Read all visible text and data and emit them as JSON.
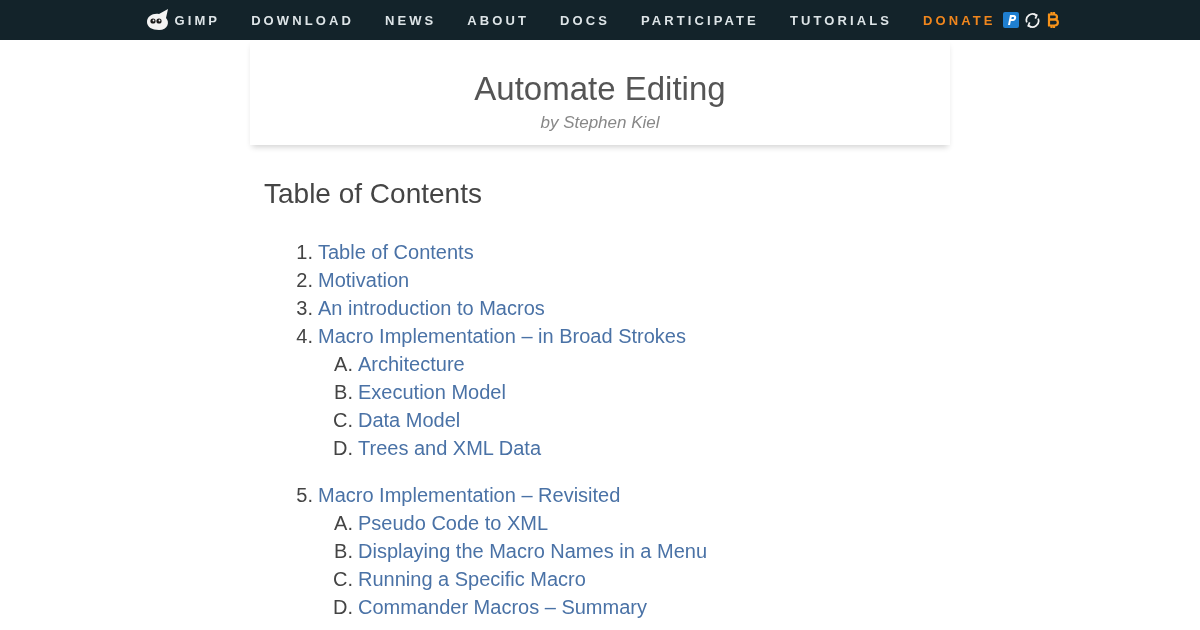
{
  "nav": {
    "items": [
      {
        "kind": "brand",
        "label": "GIMP"
      },
      {
        "kind": "link",
        "label": "DOWNLOAD"
      },
      {
        "kind": "link",
        "label": "NEWS"
      },
      {
        "kind": "link",
        "label": "ABOUT"
      },
      {
        "kind": "link",
        "label": "DOCS"
      },
      {
        "kind": "link",
        "label": "PARTICIPATE"
      },
      {
        "kind": "link",
        "label": "TUTORIALS"
      },
      {
        "kind": "donate",
        "label": "DONATE"
      }
    ]
  },
  "header": {
    "title": "Automate Editing",
    "byline": "by Stephen Kiel"
  },
  "toc": {
    "heading": "Table of Contents",
    "items": [
      {
        "number": "1.",
        "label": "Table of Contents"
      },
      {
        "number": "2.",
        "label": "Motivation"
      },
      {
        "number": "3.",
        "label": "An introduction to Macros"
      },
      {
        "number": "4.",
        "label": "Macro Implementation – in Broad Strokes",
        "children": [
          {
            "number": "A.",
            "label": "Architecture"
          },
          {
            "number": "B.",
            "label": "Execution Model"
          },
          {
            "number": "C.",
            "label": "Data Model"
          },
          {
            "number": "D.",
            "label": "Trees and XML Data"
          }
        ]
      },
      {
        "number": "5.",
        "label": "Macro Implementation – Revisited",
        "children": [
          {
            "number": "A.",
            "label": "Pseudo Code to XML"
          },
          {
            "number": "B.",
            "label": "Displaying the Macro Names in a Menu"
          },
          {
            "number": "C.",
            "label": "Running a Specific Macro"
          },
          {
            "number": "D.",
            "label": "Commander Macros – Summary"
          }
        ]
      }
    ]
  }
}
